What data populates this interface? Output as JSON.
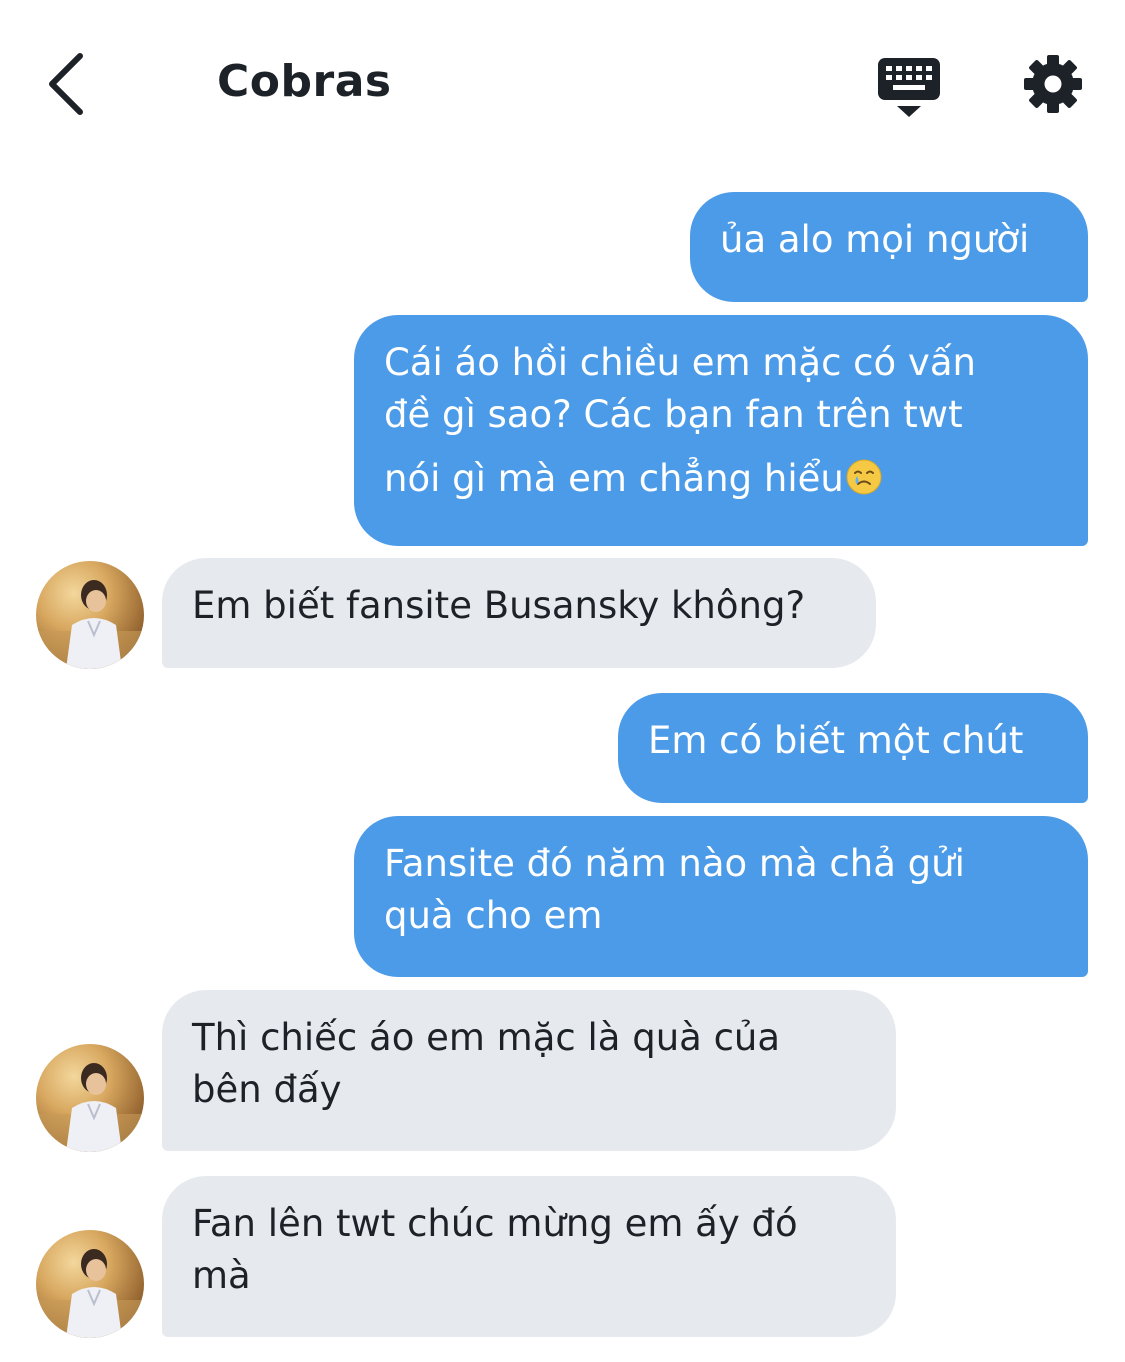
{
  "header": {
    "title": "Cobras",
    "back_icon": "chevron-left-icon",
    "keyboard_icon": "keyboard-hide-icon",
    "settings_icon": "gear-icon"
  },
  "colors": {
    "outgoing_bubble": "#4c9be8",
    "incoming_bubble": "#e6e9ee",
    "text_dark": "#1c2228"
  },
  "messages": [
    {
      "direction": "out",
      "lines": [
        "ủa alo mọi người"
      ]
    },
    {
      "direction": "out",
      "lines": [
        "Cái áo hồi chiều em mặc có vấn",
        "đề gì sao? Các bạn fan trên twt",
        "nói gì mà em chẳng hiểu"
      ],
      "trailing_emoji": "crying-face-emoji"
    },
    {
      "direction": "in",
      "lines": [
        "Em biết fansite Busansky không?"
      ]
    },
    {
      "direction": "out",
      "lines": [
        "Em có biết một chút"
      ]
    },
    {
      "direction": "out",
      "lines": [
        "Fansite đó năm nào mà chả gửi",
        "quà cho em"
      ]
    },
    {
      "direction": "in",
      "lines": [
        "Thì chiếc áo em mặc là quà của",
        "bên đấy"
      ]
    },
    {
      "direction": "in",
      "lines": [
        "Fan lên twt chúc mừng em ấy đó",
        "mà"
      ]
    }
  ]
}
